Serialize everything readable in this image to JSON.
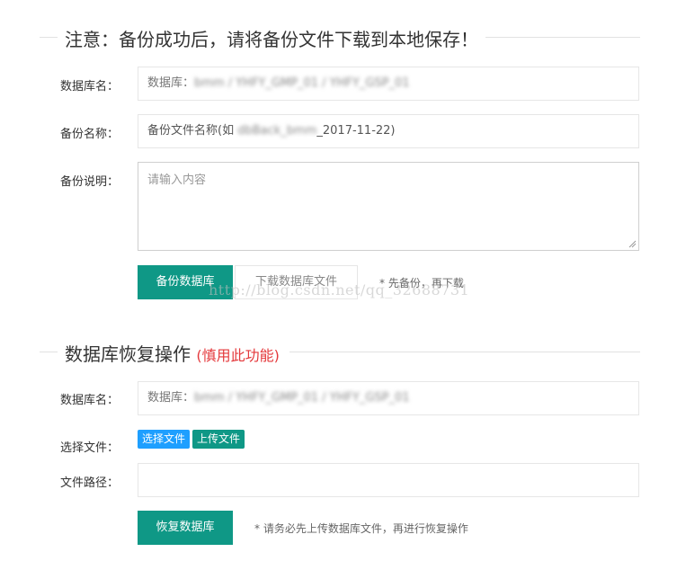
{
  "backup": {
    "title": "注意：备份成功后，请将备份文件下载到本地保存！",
    "db_label": "数据库名：",
    "db_prefix": "数据库：",
    "db_value": "bmm / YHFY_GMP_01 / YHFY_GSP_01",
    "name_label": "备份名称：",
    "name_prefix": "备份文件名称(如 ",
    "name_blur": "dbBack_bmm",
    "name_suffix": "_2017-11-22)",
    "desc_label": "备份说明：",
    "desc_placeholder": "请输入内容",
    "backup_button": "备份数据库",
    "download_button": "下载数据库文件",
    "hint": "* 先备份，再下载"
  },
  "restore": {
    "title": "数据库恢复操作",
    "title_warning": "(慎用此功能)",
    "db_label": "数据库名：",
    "db_prefix": "数据库：",
    "db_value": "bmm / YHFY_GMP_01 / YHFY_GSP_01",
    "file_label": "选择文件：",
    "choose_button": "选择文件",
    "upload_button": "上传文件",
    "path_label": "文件路径：",
    "path_value": "",
    "restore_button": "恢复数据库",
    "hint": "* 请务必先上传数据库文件，再进行恢复操作"
  },
  "watermark": "http://blog.csdn.net/qq_32688731",
  "colors": {
    "primary": "#0f9886",
    "choose_button": "#1e9fff",
    "upload_button": "#0f9886",
    "warning": "#e4393c"
  }
}
